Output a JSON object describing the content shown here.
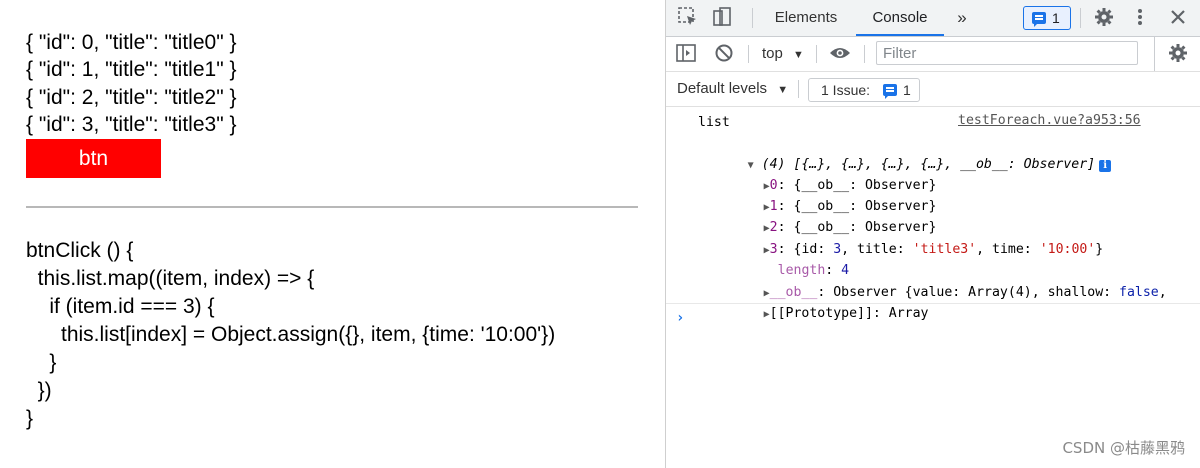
{
  "app": {
    "json_lines": [
      "{ \"id\": 0, \"title\": \"title0\" }",
      "{ \"id\": 1, \"title\": \"title1\" }",
      "{ \"id\": 2, \"title\": \"title2\" }",
      "{ \"id\": 3, \"title\": \"title3\" }"
    ],
    "button_label": "btn",
    "button_color": "#ff0000",
    "code_lines": [
      "btnClick () {",
      "  this.list.map((item, index) => {",
      "    if (item.id === 3) {",
      "      this.list[index] = Object.assign({}, item, {time: '10:00'})",
      "    }",
      "  })",
      "}"
    ]
  },
  "devtools": {
    "tabs": {
      "elements": "Elements",
      "console": "Console"
    },
    "more_tabs_icon": "»",
    "issues_count": "1",
    "context": "top",
    "filter_placeholder": "Filter",
    "levels": "Default levels",
    "issue_chip_text": "1 Issue:",
    "issue_chip_count": "1",
    "accent": "#1a73e8"
  },
  "console": {
    "log_label": "list",
    "source": "testForeach.vue?a953:56",
    "array_summary": "(4) [{…}, {…}, {…}, {…}, __ob__: Observer]",
    "info_glyph": "i",
    "items": [
      {
        "key": "0",
        "value": "{__ob__: Observer}"
      },
      {
        "key": "1",
        "value": "{__ob__: Observer}"
      },
      {
        "key": "2",
        "value": "{__ob__: Observer}"
      }
    ],
    "item3": {
      "key": "3",
      "id_label": "{id: ",
      "id_value": "3",
      "title_label": ", title: ",
      "title_value": "'title3'",
      "time_label": ", time: ",
      "time_value": "'10:00'",
      "close": "}"
    },
    "length_key": "length",
    "length_value": "4",
    "ob_key": "__ob__",
    "ob_value": "Observer {value: Array(4), shallow: ",
    "ob_false": "false",
    "ob_tail": ",",
    "proto_key": "[[Prototype]]",
    "proto_value": "Array",
    "prompt": "›"
  },
  "watermark": "CSDN @枯藤黑鸦"
}
